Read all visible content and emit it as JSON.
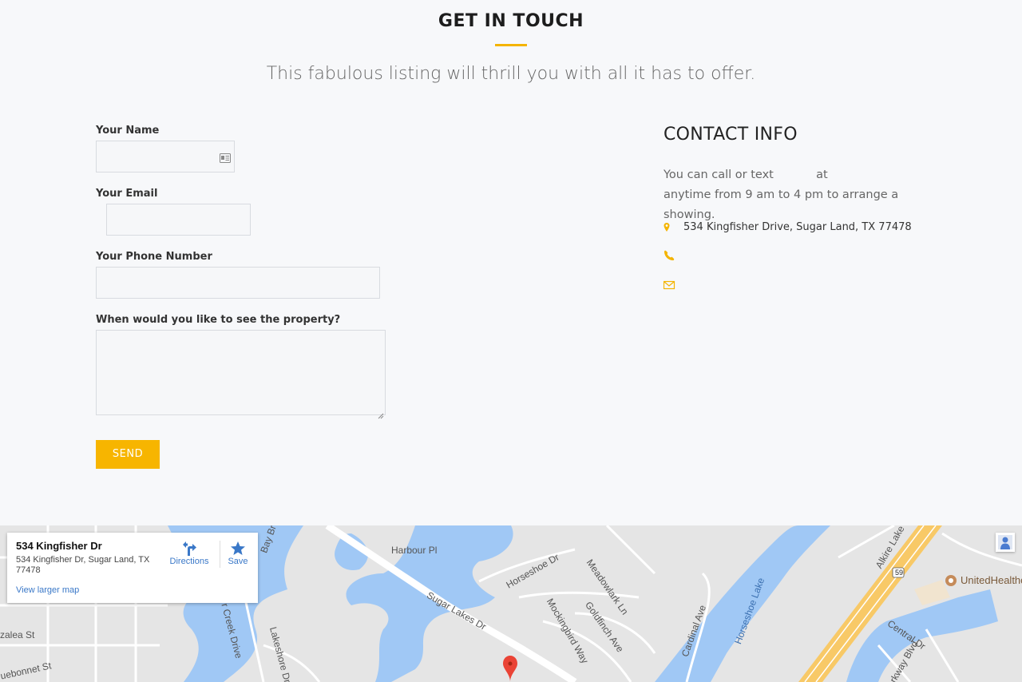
{
  "header": {
    "title": "GET IN TOUCH",
    "subtitle": "This fabulous listing will thrill you with all it has to offer."
  },
  "form": {
    "name_label": "Your Name",
    "email_label": "Your Email",
    "phone_label": "Your Phone Number",
    "visit_label": "When would you like to see the property?",
    "send_label": "SEND"
  },
  "contact": {
    "title": "CONTACT INFO",
    "text_part1": "You can call or text",
    "text_at": "at",
    "text_part2": "anytime from 9 am to 4 pm to arrange a showing.",
    "address": "534 Kingfisher Drive, Sugar Land, TX 77478",
    "accent_color": "#f4b400"
  },
  "map": {
    "place_name": "534 Kingfisher Dr",
    "place_address": "534 Kingfisher Dr, Sugar Land, TX 77478",
    "directions_label": "Directions",
    "save_label": "Save",
    "larger_map_label": "View larger map",
    "poi_label": "UnitedHealthc",
    "street_labels": {
      "harbour": "Harbour Pl",
      "horseshoe_dr": "Horseshoe Dr",
      "sugar_lakes": "Sugar Lakes Dr",
      "meadowlark": "Meadowlark Ln",
      "mockingbird": "Mockingbird Way",
      "goldfinch": "Goldfinch Ave",
      "cardinal": "Cardinal Ave",
      "horseshoe_lake": "Horseshoe Lake",
      "alkire": "Alkire Lake",
      "central": "Central Dr",
      "parkway": "Parkway Blvd",
      "azalea": "zalea St",
      "bonnet": "uebonnet St",
      "creek": "r Creek Drive",
      "lakeshore": "Lakeshore Dr",
      "bay": "Bay Br",
      "hwy": "59"
    },
    "colors": {
      "land": "#e5e5e5",
      "water": "#a0c8f5",
      "road": "#ffffff",
      "highway": "#f8c967",
      "marker": "#ea4335"
    }
  }
}
